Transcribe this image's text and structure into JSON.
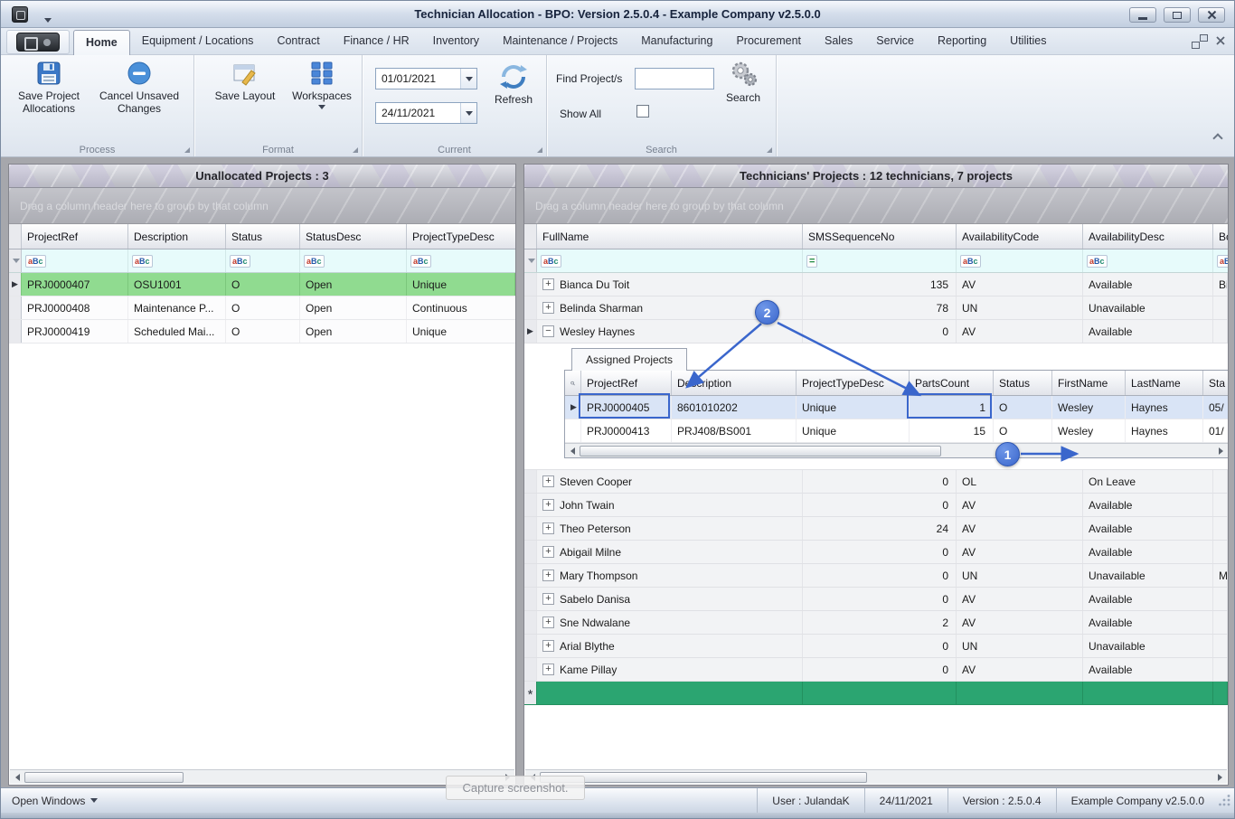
{
  "icons": {
    "row_arrow": "▶",
    "abc_a": "a",
    "abc_b": "B",
    "abc_c": "c",
    "equals": "=",
    "asterisk": "*"
  },
  "colors": {
    "accent_blue": "#3a66cc",
    "selected_row_green": "#90db90",
    "new_row_green": "#2ba571",
    "detail_selected_blue": "#d9e4f6",
    "filter_row_cyan": "#e7fbfb"
  },
  "window": {
    "title": "Technician Allocation - BPO: Version 2.5.0.4 - Example Company v2.5.0.0"
  },
  "ribbon": {
    "tabs": [
      "Home",
      "Equipment / Locations",
      "Contract",
      "Finance / HR",
      "Inventory",
      "Maintenance / Projects",
      "Manufacturing",
      "Procurement",
      "Sales",
      "Service",
      "Reporting",
      "Utilities"
    ],
    "groups": {
      "process": {
        "caption": "Process",
        "save_line1": "Save Project",
        "save_line2": "Allocations",
        "cancel_line1": "Cancel Unsaved",
        "cancel_line2": "Changes"
      },
      "format": {
        "caption": "Format",
        "save_layout": "Save Layout",
        "workspaces": "Workspaces"
      },
      "current": {
        "caption": "Current",
        "date_from": "01/01/2021",
        "date_to": "24/11/2021",
        "refresh": "Refresh"
      },
      "search": {
        "caption": "Search",
        "find_label": "Find Project/s",
        "find_value": "",
        "show_all": "Show All",
        "search_button": "Search"
      }
    }
  },
  "left_panel": {
    "caption": "Unallocated Projects : 3",
    "group_hint": "Drag a column header here to group by that column",
    "columns": [
      "ProjectRef",
      "Description",
      "Status",
      "StatusDesc",
      "ProjectTypeDesc"
    ],
    "rows": [
      {
        "c0": "PRJ0000407",
        "c1": "OSU1001",
        "c2": "O",
        "c3": "Open",
        "c4": "Unique"
      },
      {
        "c0": "PRJ0000408",
        "c1": "Maintenance P...",
        "c2": "O",
        "c3": "Open",
        "c4": "Continuous"
      },
      {
        "c0": "PRJ0000419",
        "c1": "Scheduled Mai...",
        "c2": "O",
        "c3": "Open",
        "c4": "Unique"
      }
    ]
  },
  "right_panel": {
    "caption": "Technicians' Projects : 12 technicians, 7 projects",
    "group_hint": "Drag a column header here to group by that column",
    "columns": [
      "FullName",
      "SMSSequenceNo",
      "AvailabilityCode",
      "AvailabilityDesc",
      "Boo"
    ],
    "rows": [
      {
        "exp": "+",
        "name": "Bianca Du Toit",
        "sms": "135",
        "code": "AV",
        "desc": "Available",
        "cut": "Bia"
      },
      {
        "exp": "+",
        "name": "Belinda Sharman",
        "sms": "78",
        "code": "UN",
        "desc": "Unavailable",
        "cut": ""
      },
      {
        "exp": "−",
        "name": "Wesley Haynes",
        "sms": "0",
        "code": "AV",
        "desc": "Available",
        "cut": ""
      },
      {
        "exp": "+",
        "name": "Steven Cooper",
        "sms": "0",
        "code": "OL",
        "desc": "On Leave",
        "cut": ""
      },
      {
        "exp": "+",
        "name": "John Twain",
        "sms": "0",
        "code": "AV",
        "desc": "Available",
        "cut": ""
      },
      {
        "exp": "+",
        "name": "Theo Peterson",
        "sms": "24",
        "code": "AV",
        "desc": "Available",
        "cut": ""
      },
      {
        "exp": "+",
        "name": "Abigail Milne",
        "sms": "0",
        "code": "AV",
        "desc": "Available",
        "cut": ""
      },
      {
        "exp": "+",
        "name": "Mary Thompson",
        "sms": "0",
        "code": "UN",
        "desc": "Unavailable",
        "cut": "Ma"
      },
      {
        "exp": "+",
        "name": "Sabelo Danisa",
        "sms": "0",
        "code": "AV",
        "desc": "Available",
        "cut": ""
      },
      {
        "exp": "+",
        "name": "Sne Ndwalane",
        "sms": "2",
        "code": "AV",
        "desc": "Available",
        "cut": ""
      },
      {
        "exp": "+",
        "name": "Arial Blythe",
        "sms": "0",
        "code": "UN",
        "desc": "Unavailable",
        "cut": ""
      },
      {
        "exp": "+",
        "name": "Kame Pillay",
        "sms": "0",
        "code": "AV",
        "desc": "Available",
        "cut": ""
      }
    ],
    "detail": {
      "tab": "Assigned Projects",
      "columns": [
        "ProjectRef",
        "Description",
        "ProjectTypeDesc",
        "PartsCount",
        "Status",
        "FirstName",
        "LastName",
        "Sta"
      ],
      "rows": [
        {
          "c0": "PRJ0000405",
          "c1": "8601010202",
          "c2": "Unique",
          "c3": "1",
          "c4": "O",
          "c5": "Wesley",
          "c6": "Haynes",
          "c7": "05/"
        },
        {
          "c0": "PRJ0000413",
          "c1": "PRJ408/BS001",
          "c2": "Unique",
          "c3": "15",
          "c4": "O",
          "c5": "Wesley",
          "c6": "Haynes",
          "c7": "01/"
        }
      ]
    }
  },
  "status_bar": {
    "open_windows": "Open Windows",
    "user": "User : JulandaK",
    "date": "24/11/2021",
    "version": "Version : 2.5.0.4",
    "company": "Example Company v2.5.0.0"
  },
  "callouts": {
    "step1": "1",
    "step2": "2"
  },
  "overlay_text": "Capture screenshot."
}
